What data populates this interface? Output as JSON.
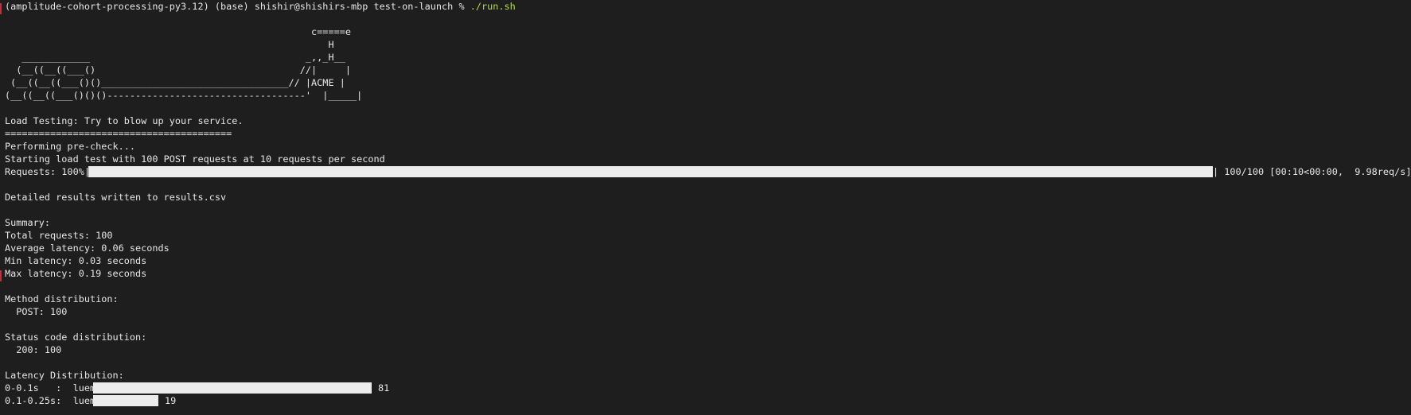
{
  "prompt": {
    "env": "(amplitude-cohort-processing-py3.12) (base) shishir@shishirs-mbp test-on-launch % ",
    "command": "./run.sh"
  },
  "banner": [
    "                                                      c=====e",
    "                                                         H",
    "   ____________                                      _,,_H__",
    "  (__((__((___()                                    //|     |",
    " (__((__((___()()_________________________________// |ACME |",
    "(__((__((___()()()-----------------------------------'  |_____|"
  ],
  "output": {
    "tagline": "Load Testing: Try to blow up your service.",
    "divider": "========================================",
    "precheck": "Performing pre-check...",
    "start": "Starting load test with 100 POST requests at 10 requests per second",
    "progress": {
      "prefix": "Requests: 100%|",
      "suffix": "| 100/100 [00:10<00:00,  9.98req/s]",
      "fraction": 1.0
    },
    "results_file": "Detailed results written to results.csv",
    "summary_title": "Summary:",
    "total_requests": "Total requests: 100",
    "avg_latency": "Average latency: 0.06 seconds",
    "min_latency": "Min latency: 0.03 seconds",
    "max_latency": "Max latency: 0.19 seconds",
    "method_title": "Method distribution:",
    "method_post": "  POST: 100",
    "status_title": "Status code distribution:",
    "status_200": "  200: 100",
    "latency_title": "Latency Distribution:",
    "latency_buckets": [
      {
        "label": "0-0.1s   :  luem",
        "count": "81",
        "fraction": 0.81
      },
      {
        "label": "0.1-0.25s:  luem",
        "count": "19",
        "fraction": 0.19
      }
    ]
  },
  "colors": {
    "background": "#1e1e1e",
    "text": "#e6e6e6",
    "command": "#b6d94c",
    "bar": "#ececec"
  }
}
